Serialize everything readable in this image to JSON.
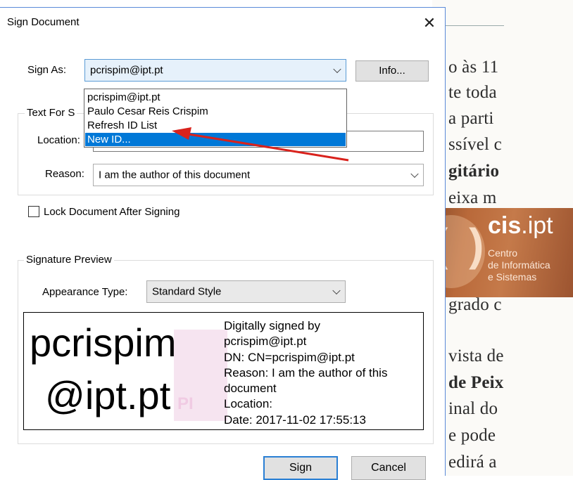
{
  "dialog": {
    "title": "Sign Document",
    "close_glyph": "✕",
    "sign_as": {
      "label": "Sign As:",
      "selected": "pcrispim@ipt.pt",
      "info_button": "Info..."
    },
    "dropdown": {
      "items": [
        "pcrispim@ipt.pt",
        "Paulo Cesar Reis Crispim",
        "Refresh ID List",
        "New ID..."
      ],
      "highlighted_index": 3
    },
    "text_group": {
      "title": "Text For S",
      "location_label": "Location:",
      "location_value": "",
      "reason_label": "Reason:",
      "reason_value": "I am the author of this document"
    },
    "lock_checkbox": {
      "label": "Lock Document After Signing",
      "checked": false
    },
    "preview_group": {
      "title": "Signature Preview",
      "appearance_label": "Appearance Type:",
      "appearance_value": "Standard Style"
    },
    "signature_preview": {
      "name_line1": "pcrispim",
      "name_line2": "@ipt.pt",
      "watermark": "PI",
      "details": [
        "Digitally signed by",
        "pcrispim@ipt.pt",
        "DN: CN=pcrispim@ipt.pt",
        "Reason: I am the author of this",
        "document",
        "Location:",
        "Date: 2017-11-02 17:55:13"
      ]
    },
    "buttons": {
      "sign": "Sign",
      "cancel": "Cancel"
    }
  },
  "background_document": {
    "lines": [
      {
        "text": "o às 11",
        "bold": false
      },
      {
        "text": "te toda",
        "bold": false
      },
      {
        "text": "a parti",
        "bold": false
      },
      {
        "text": "ssível c",
        "bold": false
      },
      {
        "text": "gitário",
        "bold": true
      },
      {
        "text": "eixa m",
        "bold": false
      },
      {
        "text": "grado c",
        "bold": false
      },
      {
        "text": "vista de",
        "bold": false
      },
      {
        "text": "de Peix",
        "bold": true
      },
      {
        "text": "inal do",
        "bold": false
      },
      {
        "text": "e pode",
        "bold": false
      },
      {
        "text": "edirá a",
        "bold": false
      }
    ]
  },
  "logo": {
    "name_bold": "cis",
    "name_rest": ".ipt",
    "line1": "Centro",
    "line2": "de Informática",
    "line3": "e Sistemas"
  },
  "annotation": {
    "arrow_color": "#d9221c"
  },
  "colors": {
    "accent": "#0078d7",
    "focus_border": "#2a7fd4"
  }
}
